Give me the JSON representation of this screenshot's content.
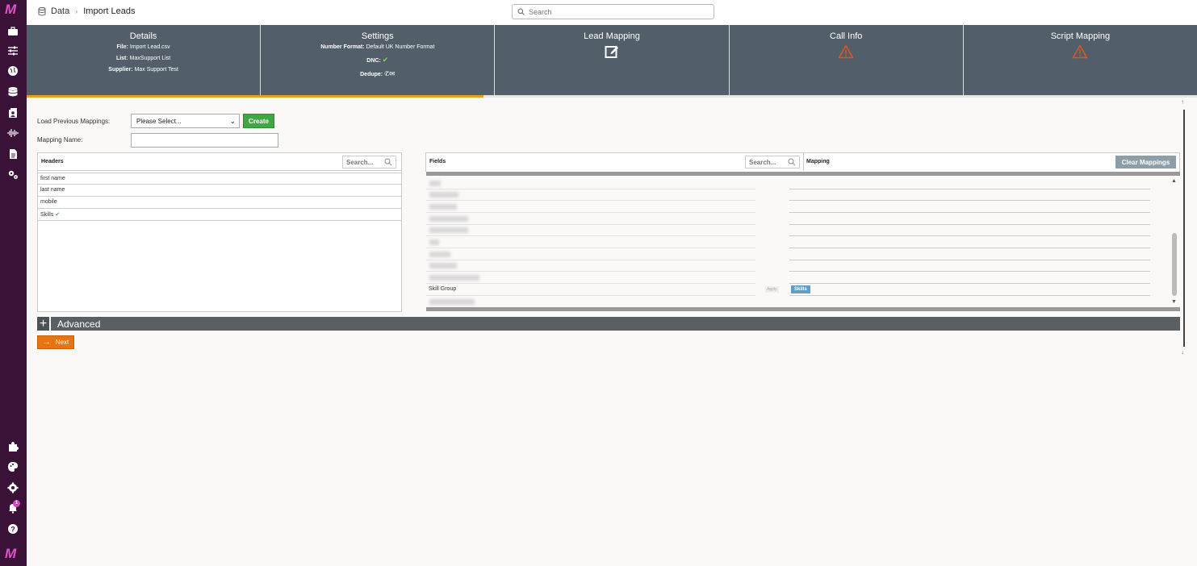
{
  "sidebar": {
    "logo": "M",
    "items": [
      {
        "name": "briefcase-icon"
      },
      {
        "name": "sliders-icon"
      },
      {
        "name": "globe-icon"
      },
      {
        "name": "database-icon"
      },
      {
        "name": "contacts-icon"
      },
      {
        "name": "waveform-icon"
      },
      {
        "name": "document-icon"
      },
      {
        "name": "gears-icon"
      }
    ],
    "bottom_items": [
      {
        "name": "puzzle-icon"
      },
      {
        "name": "palette-icon"
      },
      {
        "name": "gear-icon"
      },
      {
        "name": "bell-icon"
      },
      {
        "name": "help-icon"
      }
    ],
    "notification_count": "1"
  },
  "breadcrumb": {
    "root": "Data",
    "current": "Import Leads"
  },
  "search": {
    "placeholder": "Search"
  },
  "steps": {
    "details": {
      "title": "Details",
      "file_label": "File:",
      "file_value": "Import Lead.csv",
      "list_label": "List:",
      "list_value": "MaxSupport List",
      "supplier_label": "Supplier:",
      "supplier_value": "Max Support Test"
    },
    "settings": {
      "title": "Settings",
      "number_format_label": "Number Format:",
      "number_format_value": "Default UK Number Format",
      "dnc_label": "DNC:",
      "dedupe_label": "Dedupe:"
    },
    "lead_mapping": {
      "title": "Lead Mapping"
    },
    "call_info": {
      "title": "Call Info"
    },
    "script_mapping": {
      "title": "Script Mapping"
    }
  },
  "progress_fraction": 0.39,
  "form": {
    "load_label": "Load Previous Mappings:",
    "select_value": "Please Select...",
    "create_label": "Create",
    "mapping_name_label": "Mapping Name:"
  },
  "headers_panel": {
    "title": "Headers",
    "search_placeholder": "Search...",
    "rows": [
      "first name",
      "last name",
      "mobile",
      "Skills"
    ]
  },
  "fields_panel": {
    "title": "Fields",
    "search_placeholder": "Search...",
    "mapping_title": "Mapping",
    "clear_label": "Clear Mappings",
    "skill_field": "Skill Group",
    "apply_label": "Apply",
    "skill_mapping": "Skills"
  },
  "advanced": {
    "label": "Advanced"
  },
  "next_label": "Next",
  "colors": {
    "sidebar": "#3a1238",
    "brand": "#e052c8",
    "steps_bg": "#525f6a",
    "progress": "#e2a41a",
    "create": "#3fa845",
    "next": "#e8730f",
    "warning": "#e0541e"
  }
}
